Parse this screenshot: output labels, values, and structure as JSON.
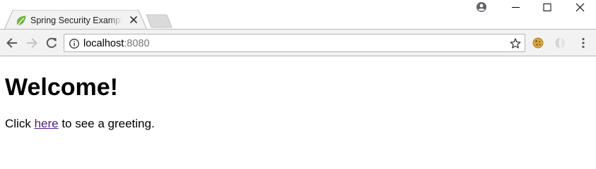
{
  "browser": {
    "tab": {
      "title": "Spring Security Example",
      "favicon": "spring-leaf-icon"
    },
    "address_bar": {
      "host": "localhost",
      "port": ":8080"
    },
    "toolbar_icons": [
      "back-arrow-icon",
      "forward-arrow-icon",
      "reload-icon",
      "info-icon",
      "star-icon",
      "cookie-extension-icon",
      "extension-icon",
      "menu-kebab-icon"
    ],
    "window_controls": [
      "profile-icon",
      "minimize-icon",
      "maximize-icon",
      "close-icon"
    ],
    "colors": {
      "tab_bg": "#f2f2f2",
      "toolbar_bg": "#f2f2f2",
      "favicon_green": "#6db33f",
      "visited_link": "#551a8b"
    }
  },
  "page": {
    "heading": "Welcome!",
    "paragraph": {
      "before": "Click ",
      "link": "here",
      "after": " to see a greeting."
    }
  }
}
